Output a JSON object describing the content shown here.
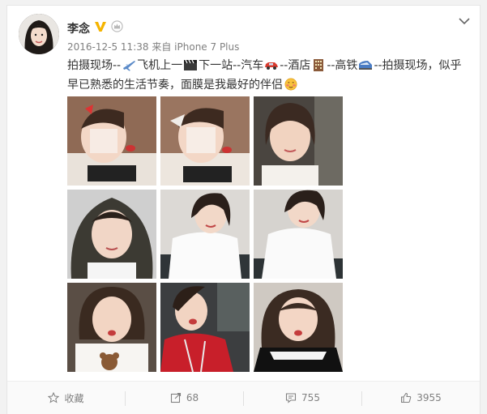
{
  "post": {
    "author": "李念",
    "timestamp": "2016-12-5 11:38",
    "source_prefix": "来自",
    "source_device": "iPhone 7 Plus",
    "text_parts": [
      "拍摄现场--",
      "飞机上一",
      "下一站--汽车",
      "--酒店",
      "--高铁",
      "--拍摄现场，似乎早已熟悉的生活节奏，面膜是我最好的伴侣"
    ]
  },
  "icons": {
    "verified": "verified-v-icon",
    "member": "member-crown-icon",
    "menu": "chevron-down-icon",
    "plane": "airplane-emoji",
    "clapper": "clapper-board-emoji",
    "car": "car-emoji",
    "hotel": "hotel-emoji",
    "train": "bullet-train-emoji",
    "smile": "blush-face-emoji",
    "favorite": "star-icon",
    "repost": "repost-icon",
    "comment": "comment-icon",
    "like": "thumb-up-icon"
  },
  "actions": {
    "favorite_label": "收藏",
    "repost_count": "68",
    "comment_count": "755",
    "like_count": "3955"
  },
  "colors": {
    "verified": "#f5b400",
    "text": "#333333",
    "meta": "#808080"
  }
}
